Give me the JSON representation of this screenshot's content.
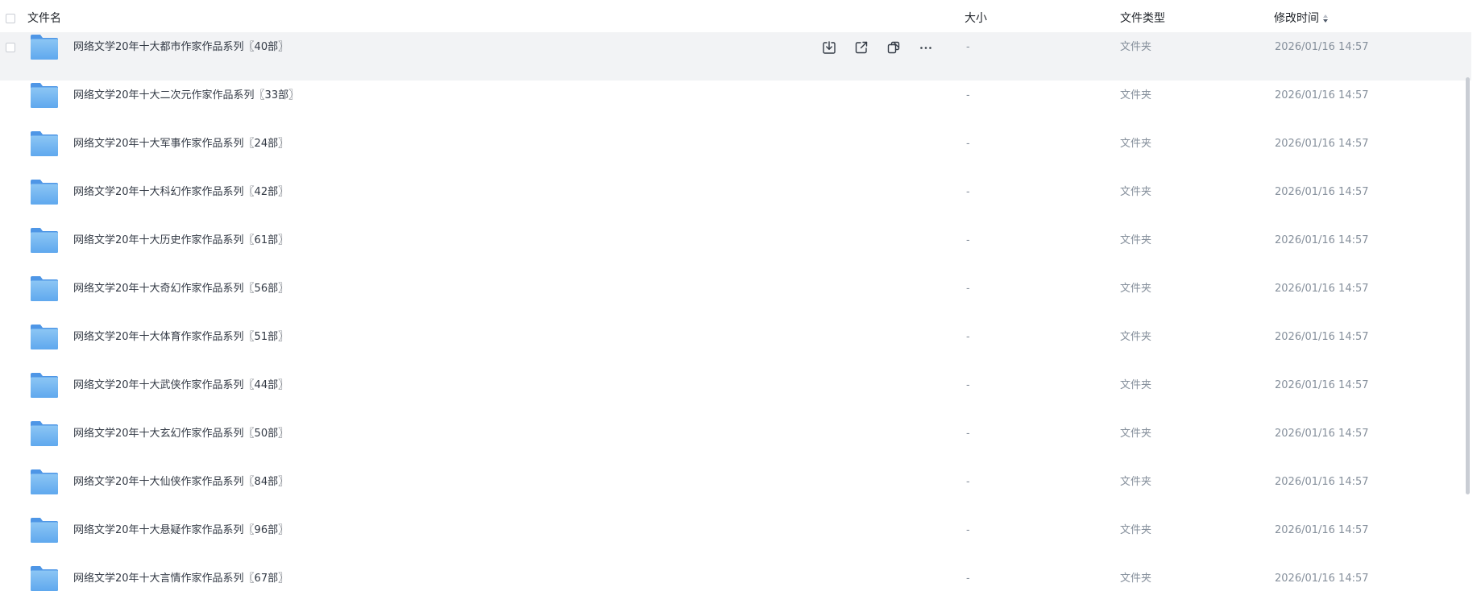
{
  "header": {
    "name": "文件名",
    "size": "大小",
    "type": "文件类型",
    "time": "修改时间"
  },
  "rows": [
    {
      "name": "网络文学20年十大都市作家作品系列〖40部〗",
      "size": "-",
      "type": "文件夹",
      "time": "2026/01/16 14:57"
    },
    {
      "name": "网络文学20年十大二次元作家作品系列〖33部〗",
      "size": "-",
      "type": "文件夹",
      "time": "2026/01/16 14:57"
    },
    {
      "name": "网络文学20年十大军事作家作品系列〖24部〗",
      "size": "-",
      "type": "文件夹",
      "time": "2026/01/16 14:57"
    },
    {
      "name": "网络文学20年十大科幻作家作品系列〖42部〗",
      "size": "-",
      "type": "文件夹",
      "time": "2026/01/16 14:57"
    },
    {
      "name": "网络文学20年十大历史作家作品系列〖61部〗",
      "size": "-",
      "type": "文件夹",
      "time": "2026/01/16 14:57"
    },
    {
      "name": "网络文学20年十大奇幻作家作品系列〖56部〗",
      "size": "-",
      "type": "文件夹",
      "time": "2026/01/16 14:57"
    },
    {
      "name": "网络文学20年十大体育作家作品系列〖51部〗",
      "size": "-",
      "type": "文件夹",
      "time": "2026/01/16 14:57"
    },
    {
      "name": "网络文学20年十大武侠作家作品系列〖44部〗",
      "size": "-",
      "type": "文件夹",
      "time": "2026/01/16 14:57"
    },
    {
      "name": "网络文学20年十大玄幻作家作品系列〖50部〗",
      "size": "-",
      "type": "文件夹",
      "time": "2026/01/16 14:57"
    },
    {
      "name": "网络文学20年十大仙侠作家作品系列〖84部〗",
      "size": "-",
      "type": "文件夹",
      "time": "2026/01/16 14:57"
    },
    {
      "name": "网络文学20年十大悬疑作家作品系列〖96部〗",
      "size": "-",
      "type": "文件夹",
      "time": "2026/01/16 14:57"
    },
    {
      "name": "网络文学20年十大言情作家作品系列〖67部〗",
      "size": "-",
      "type": "文件夹",
      "time": "2026/01/16 14:57"
    }
  ],
  "icons": {
    "folder": "folder-icon",
    "row_actions": [
      "download-icon",
      "share-icon",
      "copy-link-icon",
      "more-icon"
    ],
    "sort": "sort-desc-icon"
  },
  "colors": {
    "folder_top": "#8cc6f4",
    "folder_bottom": "#5fa8ee",
    "hover_row": "#f2f3f5",
    "muted_text": "#86909c"
  }
}
